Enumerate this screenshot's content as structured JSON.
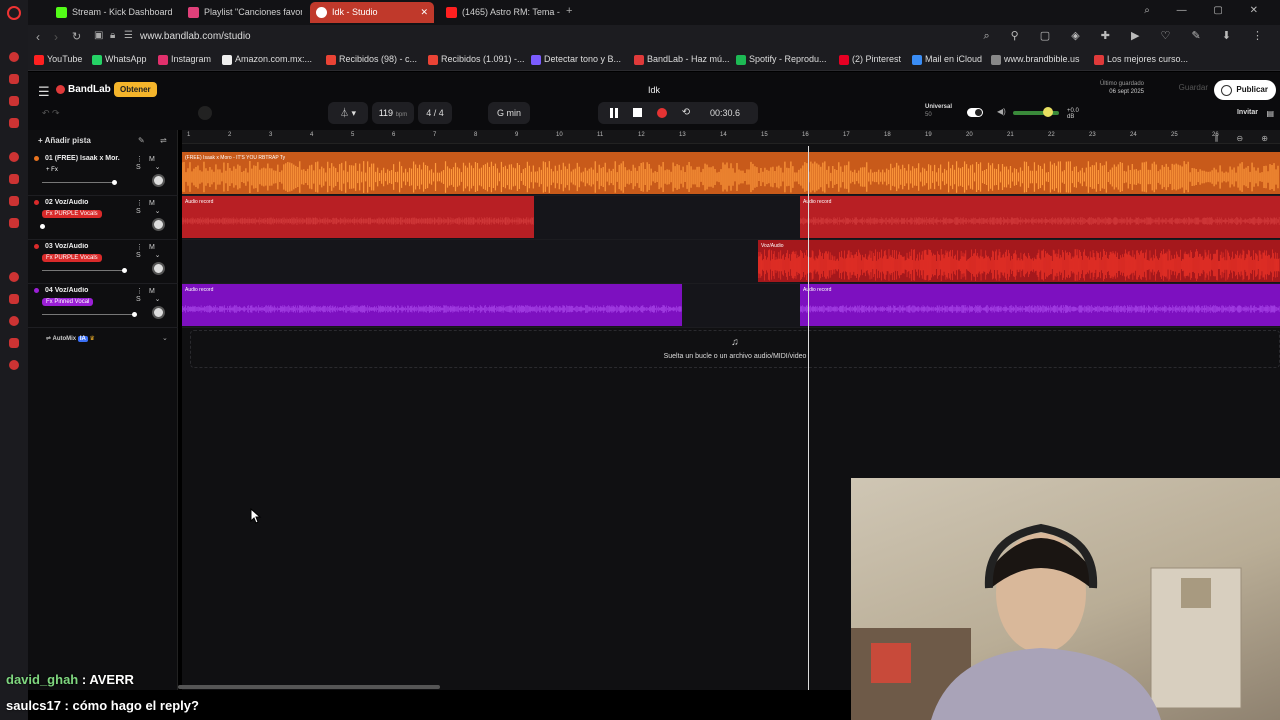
{
  "browser": {
    "tabs": [
      {
        "label": "Stream - Kick Dashboard",
        "active": false,
        "color": "#53fc18"
      },
      {
        "label": "Playlist \"Canciones favor",
        "active": false,
        "color": "#e0407a"
      },
      {
        "label": "Idk - Studio",
        "active": true,
        "color": "#ffffff"
      },
      {
        "label": "(1465) Astro RM: Tema -",
        "active": false,
        "color": "#ff2020"
      }
    ],
    "url": "www.bandlab.com/studio",
    "bookmarks": [
      {
        "label": "YouTube",
        "color": "#ff2020"
      },
      {
        "label": "WhatsApp",
        "color": "#25d366"
      },
      {
        "label": "Instagram",
        "color": "#e1306c"
      },
      {
        "label": "Amazon.com.mx:...",
        "color": "#eeeeee"
      },
      {
        "label": "Recibidos (98) - c...",
        "color": "#ea4335"
      },
      {
        "label": "Recibidos (1.091) -...",
        "color": "#ea4335"
      },
      {
        "label": "Detectar tono y B...",
        "color": "#7b5cff"
      },
      {
        "label": "BandLab - Haz mú...",
        "color": "#e03a3a"
      },
      {
        "label": "Spotify - Reprodu...",
        "color": "#1db954"
      },
      {
        "label": "(2) Pinterest",
        "color": "#e60023"
      },
      {
        "label": "Mail en iCloud",
        "color": "#3a8df5"
      },
      {
        "label": "www.brandbible.us",
        "color": "#888888"
      },
      {
        "label": "Los mejores curso...",
        "color": "#e03a3a"
      }
    ]
  },
  "studio": {
    "logo": "BandLab",
    "obtener_label": "Obtener",
    "project_title": "Idk",
    "last_saved_label": "Último guardado",
    "last_saved_date": "06 sept 2025",
    "guardar_label": "Guardar",
    "publicar_label": "Publicar",
    "invite_label": "Invitar",
    "bpm": "119",
    "bpm_unit": "bpm",
    "time_signature": "4 / 4",
    "key": "G min",
    "time": "00:30.6",
    "universal_label": "Universal",
    "universal_sub": "50",
    "gain": "+0.0 dB",
    "add_track_label": "Añadir pista",
    "automix_label": "AutoMix",
    "dropzone_text": "Suelta un bucle o un archivo audio/MIDI/video"
  },
  "tracks": [
    {
      "name": "01 (FREE) Isaak x Mor...",
      "fx": "+ Fx",
      "fx_color": "transparent",
      "color": "#e8731f",
      "volume": 0.72
    },
    {
      "name": "02 Voz/Audio",
      "fx": "Fx PURPLE Vocals",
      "fx_color": "#d92a2a",
      "color": "#d92a2a",
      "volume": 0.0
    },
    {
      "name": "03 Voz/Audio",
      "fx": "Fx PURPLE Vocals",
      "fx_color": "#d92a2a",
      "color": "#d92a2a",
      "volume": 0.82
    },
    {
      "name": "04 Voz/Audio",
      "fx": "Fx Pinned Vocal",
      "fx_color": "#9b1fd6",
      "color": "#9b1fd6",
      "volume": 0.92
    }
  ],
  "ruler_ticks": [
    "1",
    "2",
    "3",
    "4",
    "5",
    "6",
    "7",
    "8",
    "9",
    "10",
    "11",
    "12",
    "13",
    "14",
    "15",
    "16",
    "17",
    "18",
    "19",
    "20",
    "21",
    "22",
    "23",
    "24",
    "25",
    "26"
  ],
  "clips": {
    "track1_label": "(FREE) Isaak x Moro - IT'S YOU  RBTRAP Ty",
    "audio_record": "Audio record",
    "voz_audio": "Voz/Audio"
  },
  "chat": [
    {
      "user": "david_ghah",
      "message": "AVERR"
    },
    {
      "user": "saulcs17",
      "message": "cómo hago el reply?"
    }
  ]
}
